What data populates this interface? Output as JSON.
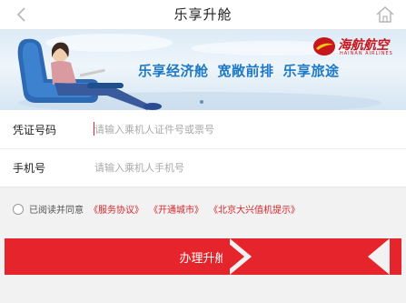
{
  "header": {
    "title": "乐享升舱",
    "back_icon": "chevron-left-icon",
    "home_icon": "home-icon"
  },
  "banner": {
    "slogans": [
      "乐享经济舱",
      "宽敞前排",
      "乐享旅途"
    ],
    "airline_logo_text": "海航航空",
    "airline_logo_sub": "HAINAN AIRLINES",
    "accent_color": "#1f79c4"
  },
  "form": {
    "voucher": {
      "label": "凭证号码",
      "value": "",
      "placeholder": "请输入乘机人证件号或票号"
    },
    "phone": {
      "label": "手机号",
      "value": "",
      "placeholder": "请输入乘机人手机号"
    }
  },
  "agreement": {
    "checked": false,
    "prefix": "已阅读并同意",
    "links": [
      "《服务协议》",
      "《开通城市》",
      "《北京大兴值机提示》"
    ]
  },
  "submit": {
    "label": "办理升舱",
    "color": "#e5242b"
  }
}
